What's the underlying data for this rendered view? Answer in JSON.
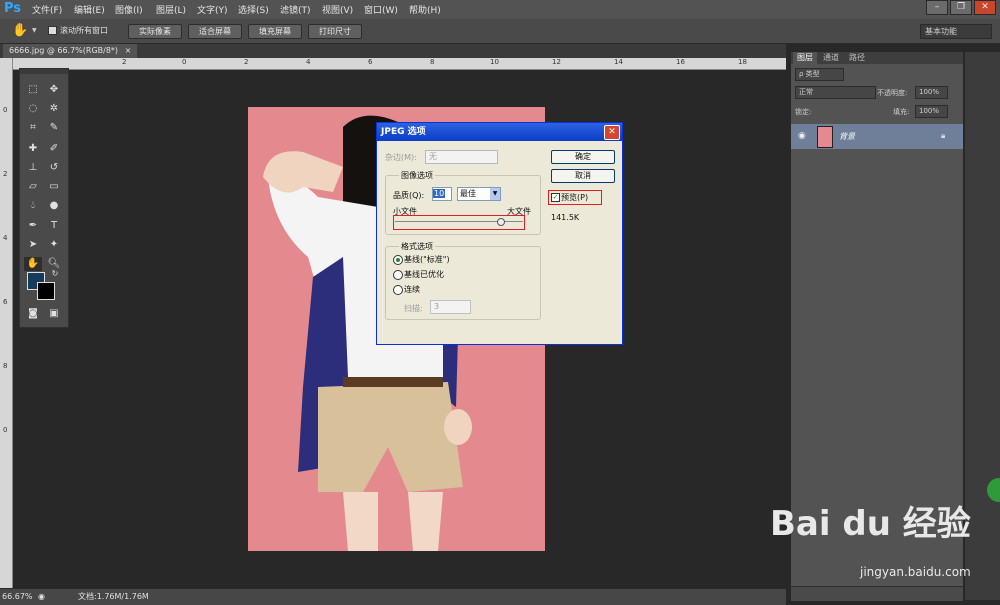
{
  "app": {
    "logo": "Ps"
  },
  "menu": [
    "文件(F)",
    "编辑(E)",
    "图像(I)",
    "图层(L)",
    "文字(Y)",
    "选择(S)",
    "滤镜(T)",
    "视图(V)",
    "窗口(W)",
    "帮助(H)"
  ],
  "options": {
    "scroll_all_label": "滚动所有窗口",
    "actual_pixels": "实际像素",
    "fit_screen": "适合屏幕",
    "fill_screen": "填充屏幕",
    "print_size": "打印尺寸",
    "workspace": "基本功能"
  },
  "document": {
    "tab_title": "6666.jpg @ 66.7%(RGB/8*)",
    "close": "×"
  },
  "rulers": {
    "top": [
      "2",
      "0",
      "2",
      "4",
      "6",
      "8",
      "10",
      "12",
      "14",
      "16",
      "18"
    ],
    "left": [
      "0",
      "2",
      "4",
      "6",
      "8",
      "0"
    ]
  },
  "dialog": {
    "title": "JPEG 选项",
    "matte_label": "杂边(M):",
    "matte_value": "无",
    "ok": "确定",
    "cancel": "取消",
    "preview": "预览(P)",
    "filesize": "141.5K",
    "image_options": "图像选项",
    "quality_label": "品质(Q):",
    "quality_value": "10",
    "quality_preset": "最佳",
    "small_file": "小文件",
    "large_file": "大文件",
    "quality_slider_fraction": 0.83,
    "format_options": "格式选项",
    "format_baseline_std": "基线(\"标准\")",
    "format_baseline_opt": "基线已优化",
    "format_progressive": "连续",
    "scans_label": "扫描:",
    "scans_value": "3"
  },
  "layers_panel": {
    "tabs": [
      "图层",
      "通道",
      "路径"
    ],
    "kind_label": "ρ 类型",
    "blend_mode": "正常",
    "opacity_label": "不透明度:",
    "opacity_value": "100%",
    "lock_label": "锁定:",
    "fill_label": "填充:",
    "fill_value": "100%",
    "layer_name": "背景"
  },
  "status": {
    "zoom": "66.67%",
    "doc_info": "文档:1.76M/1.76M"
  },
  "watermark": {
    "logo": "Bai du 经验",
    "url": "jingyan.baidu.com"
  },
  "colors": {
    "foreground": "#153c5b",
    "background": "#000000",
    "canvas_pink": "#e48a8f",
    "dialog_title": "#0a3cc8",
    "highlight_red": "#e02020"
  }
}
